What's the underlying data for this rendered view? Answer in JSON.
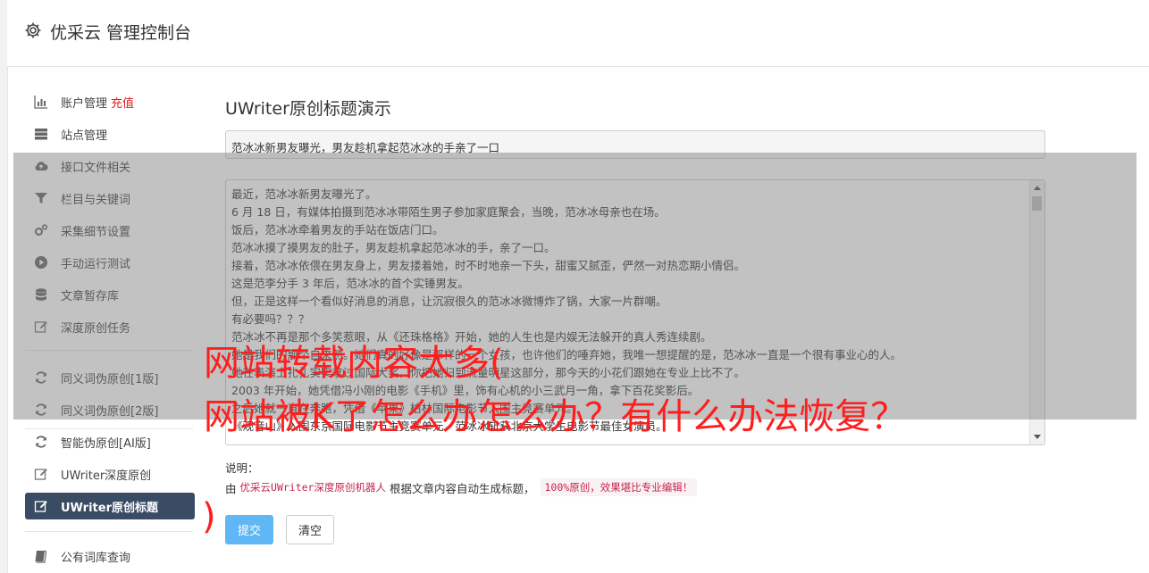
{
  "header": {
    "title": "优采云 管理控制台",
    "icon": "gear-icon"
  },
  "sidebar": {
    "items": [
      {
        "label": "账户管理",
        "badge": "充值",
        "icon": "bar-chart-icon"
      },
      {
        "label": "站点管理",
        "icon": "server-icon"
      },
      {
        "label": "接口文件相关",
        "icon": "cloud-upload-icon"
      },
      {
        "label": "栏目与关键词",
        "icon": "filter-icon"
      },
      {
        "label": "采集细节设置",
        "icon": "gears-icon"
      },
      {
        "label": "手动运行测试",
        "icon": "play-circle-icon"
      },
      {
        "label": "文章暂存库",
        "icon": "database-icon"
      },
      {
        "label": "深度原创任务",
        "icon": "edit-icon"
      },
      {
        "label": "同义词伪原创[1版]",
        "icon": "refresh-icon"
      },
      {
        "label": "同义词伪原创[2版]",
        "icon": "refresh-icon"
      },
      {
        "label": "智能伪原创[AI版]",
        "icon": "refresh-icon"
      },
      {
        "label": "UWriter深度原创",
        "icon": "edit-icon"
      },
      {
        "label": "UWriter原创标题",
        "icon": "edit-icon",
        "active": true
      },
      {
        "label": "公有词库查询",
        "icon": "book-icon"
      }
    ]
  },
  "main": {
    "title": "UWriter原创标题演示",
    "title_input_value": "范冰冰新男友曝光，男友趁机拿起范冰冰的手亲了一口",
    "content_lines": [
      "最近，范冰冰新男友曝光了。",
      "6 月 18 日，有媒体拍摄到范冰冰带陌生男子参加家庭聚会，当晚，范冰冰母亲也在场。",
      "饭后，范冰冰牵着男友的手站在饭店门口。",
      "范冰冰摸了摸男友的肚子，男友趁机拿起范冰冰的手，亲了一口。",
      "接着，范冰冰依偎在男友身上，男友搂着她，时不时地亲一下头，甜蜜又腻歪，俨然一对热恋期小情侣。",
      "这是范李分手 3 年后，范冰冰的首个实锤男友。",
      "但，正是这样一个看似好消息的消息，让沉寂很久的范冰冰微博炸了锅，大家一片群嘲。",
      "有必要吗？？？",
      "范冰冰不再是那个多笑惹眼，从《还珠格格》开始，她的人生也是内娱无法躲开的真人秀连续剧。",
      "她是我们的那个自来熟。她们真的好像是那样的一个女孩，也许他们的唾弃她，我唯一想提醒的是，范冰冰一直是一个很有事业心的人。",
      "她在表演上扎扎实实拿过国际大奖，你把她归到流量明星这部分，那今天的小花们跟她在专业上比不了。",
      "2003 年开始，她凭借冯小刚的电影《手机》里，饰有心机的小三武月一角，拿下百花奖影后。",
      "之后她就一直在奔跑，凭借《苹果》柏林国际电影节入围主竞赛单元。",
      "《观音山》入围东京国际电影节主竞赛单元，范冰冰斩获北京大学生电影节最佳女演员。"
    ],
    "note_label": "说明：",
    "note_prefix": "由",
    "note_highlight": "优采云UWriter深度原创机器人",
    "note_middle": "根据文章内容自动生成标题，",
    "note_code": "100%原创，效果堪比专业编辑！",
    "submit_label": "提交",
    "clear_label": "清空"
  },
  "overlay": {
    "line1": "网站转载内容太多(",
    "line2": "网站被K了怎么办怎么办？有什么办法恢复？",
    "line3": ")"
  },
  "colors": {
    "accent": "#3a4b64",
    "submit": "#5fb8f5",
    "badge": "#e02020",
    "overlay_text": "#ff1e1e",
    "code": "#c7254e"
  }
}
